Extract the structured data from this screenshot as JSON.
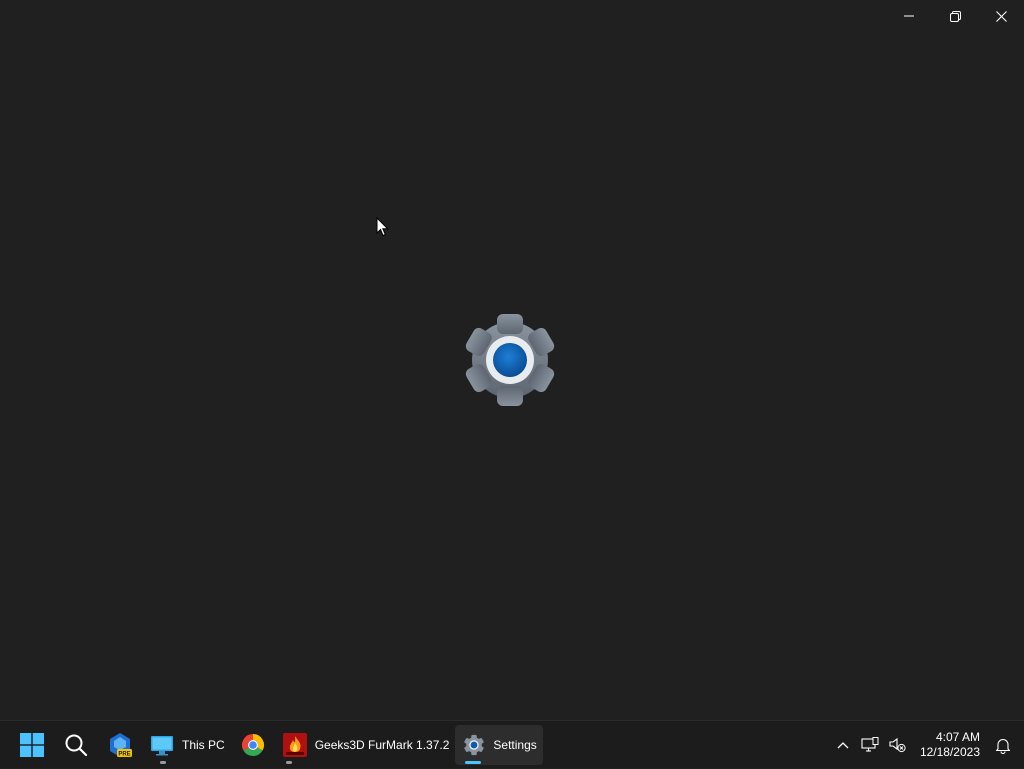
{
  "window": {
    "app": "Settings",
    "caption_buttons": {
      "minimize_icon": "minimize-icon",
      "restore_icon": "restore-icon",
      "close_icon": "close-icon"
    },
    "splash_icon": "settings-gear-icon",
    "accent_color": "#0063b1"
  },
  "taskbar": {
    "items": [
      {
        "icon": "windows-start-icon",
        "label": ""
      },
      {
        "icon": "search-icon",
        "label": ""
      },
      {
        "icon": "edge-preview-icon",
        "label": "",
        "badge": "PRE"
      },
      {
        "icon": "monitor-icon",
        "label": "This PC"
      },
      {
        "icon": "chrome-icon",
        "label": ""
      },
      {
        "icon": "furmark-icon",
        "label": "Geeks3D FurMark 1.37.2"
      },
      {
        "icon": "settings-gear-icon",
        "label": "Settings"
      }
    ],
    "active_item": "Settings",
    "tray": {
      "overflow_icon": "chevron-up-icon",
      "network_icon": "network-icon",
      "volume_icon": "volume-muted-icon",
      "notification_icon": "bell-icon"
    },
    "clock": {
      "time": "4:07 AM",
      "date": "12/18/2023"
    }
  }
}
